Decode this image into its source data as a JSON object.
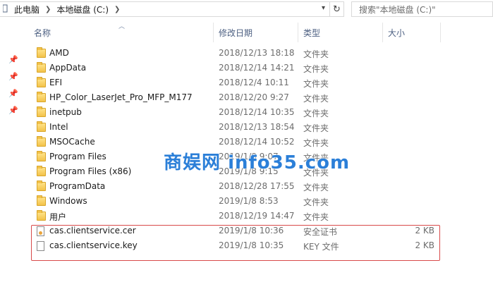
{
  "address": {
    "crumbs": [
      "此电脑",
      "本地磁盘 (C:)"
    ],
    "search_placeholder": "搜索\"本地磁盘 (C:)\""
  },
  "columns": {
    "name": "名称",
    "date": "修改日期",
    "type": "类型",
    "size": "大小"
  },
  "rows": [
    {
      "name": "AMD",
      "date": "2018/12/13 18:18",
      "type": "文件夹",
      "size": "",
      "icon": "folder-icon"
    },
    {
      "name": "AppData",
      "date": "2018/12/14 14:21",
      "type": "文件夹",
      "size": "",
      "icon": "folder-icon"
    },
    {
      "name": "EFI",
      "date": "2018/12/4 10:11",
      "type": "文件夹",
      "size": "",
      "icon": "folder-icon"
    },
    {
      "name": "HP_Color_LaserJet_Pro_MFP_M177",
      "date": "2018/12/20 9:27",
      "type": "文件夹",
      "size": "",
      "icon": "folder-icon"
    },
    {
      "name": "inetpub",
      "date": "2018/12/14 10:35",
      "type": "文件夹",
      "size": "",
      "icon": "folder-icon"
    },
    {
      "name": "Intel",
      "date": "2018/12/13 18:54",
      "type": "文件夹",
      "size": "",
      "icon": "folder-icon"
    },
    {
      "name": "MSOCache",
      "date": "2018/12/14 10:52",
      "type": "文件夹",
      "size": "",
      "icon": "folder-icon"
    },
    {
      "name": "Program Files",
      "date": "2019/1/8 9:07",
      "type": "文件夹",
      "size": "",
      "icon": "folder-icon"
    },
    {
      "name": "Program Files (x86)",
      "date": "2019/1/8 9:15",
      "type": "文件夹",
      "size": "",
      "icon": "folder-icon"
    },
    {
      "name": "ProgramData",
      "date": "2018/12/28 17:55",
      "type": "文件夹",
      "size": "",
      "icon": "folder-icon"
    },
    {
      "name": "Windows",
      "date": "2019/1/8 8:53",
      "type": "文件夹",
      "size": "",
      "icon": "folder-icon"
    },
    {
      "name": "用户",
      "date": "2018/12/19 14:47",
      "type": "文件夹",
      "size": "",
      "icon": "folder-icon"
    },
    {
      "name": "cas.clientservice.cer",
      "date": "2019/1/8 10:36",
      "type": "安全证书",
      "size": "2 KB",
      "icon": "certificate-icon"
    },
    {
      "name": "cas.clientservice.key",
      "date": "2019/1/8 10:35",
      "type": "KEY 文件",
      "size": "2 KB",
      "icon": "file-icon"
    }
  ],
  "watermark": {
    "cn": "商娱网",
    "en": "info35.com"
  },
  "colors": {
    "highlight_box": "#d84a4a",
    "header_text": "#4d6082",
    "watermark": "#2b7fd8"
  }
}
